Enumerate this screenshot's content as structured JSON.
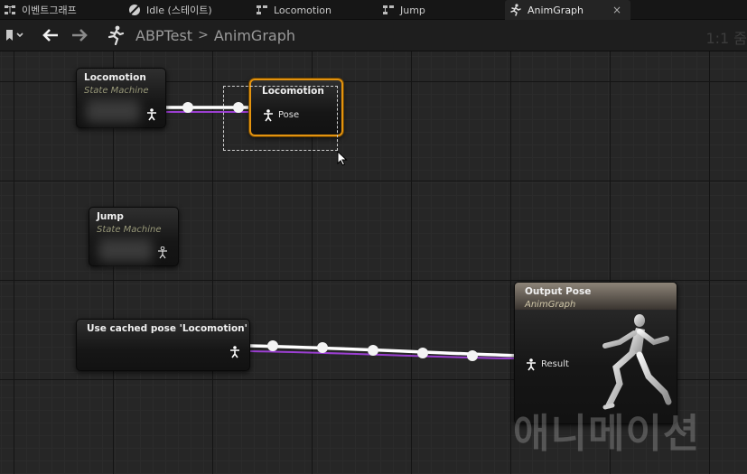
{
  "tabs": [
    {
      "label": "이벤트그래프",
      "icon": "event-graph-icon"
    },
    {
      "label": "Idle (스테이트)",
      "icon": "state-icon"
    },
    {
      "label": "Locomotion",
      "icon": "state-machine-icon"
    },
    {
      "label": "Jump",
      "icon": "state-machine-icon"
    },
    {
      "label": "AnimGraph",
      "icon": "anim-graph-icon",
      "active": true,
      "close": "×"
    }
  ],
  "breadcrumb": {
    "root": "ABPTest",
    "separator": ">",
    "current": "AnimGraph"
  },
  "zoom": "1:1 줌",
  "nodes": {
    "locomotion_sm": {
      "title": "Locomotion",
      "subtitle": "State Machine"
    },
    "locomotion_cache": {
      "title": "Locomotion",
      "pin": "Pose"
    },
    "jump_sm": {
      "title": "Jump",
      "subtitle": "State Machine"
    },
    "use_cached": {
      "title": "Use cached pose 'Locomotion'"
    },
    "output_pose": {
      "title": "Output Pose",
      "subtitle": "AnimGraph",
      "pin": "Result"
    }
  },
  "watermark": "애니메이션",
  "colors": {
    "accent": "#e3930f",
    "wire": "#ffffff",
    "wire_secondary": "#9b3fd1",
    "graph_bg": "#262626"
  }
}
